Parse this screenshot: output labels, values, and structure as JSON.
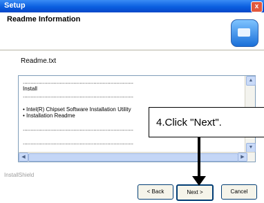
{
  "window": {
    "title": "Setup",
    "close_label": "x"
  },
  "header": {
    "title": "Readme Information"
  },
  "content": {
    "readme_label": "Readme.txt",
    "text_lines": [
      "........................................................................",
      "  Install",
      "........................................................................",
      "• Intel(R) Chipset Software Installation Utility",
      "• Installation Readme",
      "........................................................................",
      "........................................................................"
    ],
    "scroll_up": "▲",
    "scroll_down": "▼",
    "scroll_left": "◀",
    "scroll_right": "▶"
  },
  "footer": {
    "installshield": "InstallShield"
  },
  "buttons": {
    "back": "< Back",
    "next": "Next >",
    "cancel": "Cancel"
  },
  "callout": {
    "text": "4.Click  \"Next\"."
  },
  "colors": {
    "titlebar": "#0a5fe0",
    "window": "#ece9d8",
    "close": "#e2583e"
  },
  "icons": {
    "header_logo": "setup-computer-icon"
  }
}
